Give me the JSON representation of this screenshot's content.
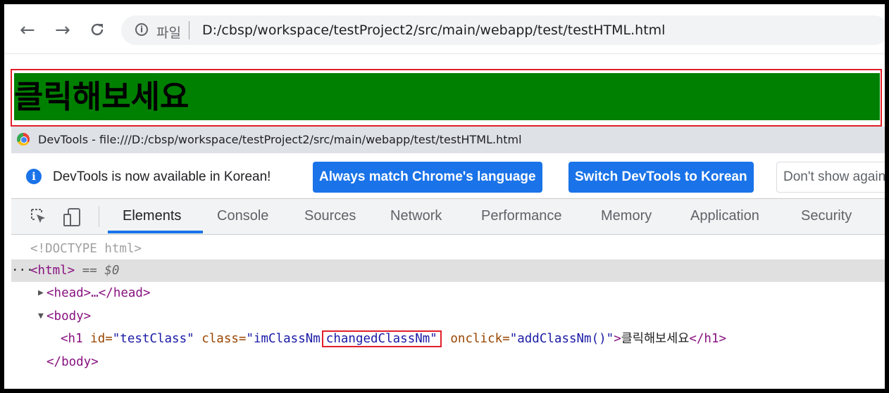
{
  "browser": {
    "nav": {
      "back": "←",
      "forward": "→",
      "reload": "C"
    },
    "omnibox": {
      "label": "파일",
      "url": "D:/cbsp/workspace/testProject2/src/main/webapp/test/testHTML.html"
    }
  },
  "page": {
    "heading": "클릭해보세요"
  },
  "devtools": {
    "title": "DevTools - file:///D:/cbsp/workspace/testProject2/src/main/webapp/test/testHTML.html",
    "infobar": {
      "message": "DevTools is now available in Korean!",
      "btn_match": "Always match Chrome's language",
      "btn_switch": "Switch DevTools to Korean",
      "btn_dont": "Don't show again"
    },
    "tabs": [
      "Elements",
      "Console",
      "Sources",
      "Network",
      "Performance",
      "Memory",
      "Application",
      "Security"
    ],
    "active_tab": "Elements",
    "dom": {
      "doctype": "<!DOCTYPE html>",
      "html_open": "<html>",
      "html_eq": " == $0",
      "ellipsis": "···",
      "head": "<head>…</head>",
      "body_open": "<body>",
      "h1_tag_open": "<h1",
      "attr_id_name": "id=",
      "attr_id_val": "\"testClass\"",
      "attr_class_name": "class=",
      "attr_class_val1": "\"imClassNm",
      "attr_class_val2": "changedClassNm\"",
      "attr_onclick_name": "onclick=",
      "attr_onclick_val": "\"addClassNm()\"",
      "h1_close_bracket": ">",
      "h1_text": "클릭해보세요",
      "h1_close": "</h1>",
      "body_close": "</body>"
    }
  },
  "colors": {
    "heading_bg": "#008000",
    "highlight": "#e0202a",
    "accent": "#1a73e8"
  }
}
